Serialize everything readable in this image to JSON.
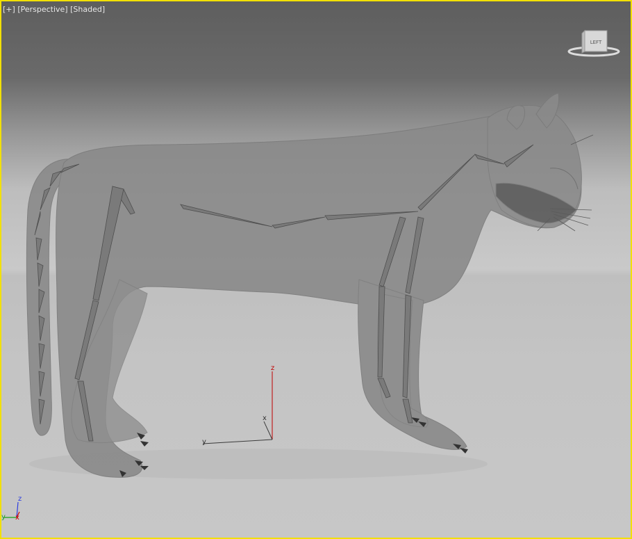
{
  "viewport": {
    "menu_plus": "[+]",
    "view_label": "[Perspective]",
    "shading_label": "[Shaded]",
    "active_border_color": "#f2e000"
  },
  "viewcube": {
    "face_label": "LEFT"
  },
  "gizmo": {
    "x_label": "x",
    "y_label": "y",
    "z_label": "z"
  },
  "corner_axes": {
    "x_label": "x",
    "y_label": "y",
    "z_label": "z"
  },
  "model": {
    "name": "puma-with-bones",
    "icon": "puma-mesh",
    "color": "#8a8a8a"
  }
}
